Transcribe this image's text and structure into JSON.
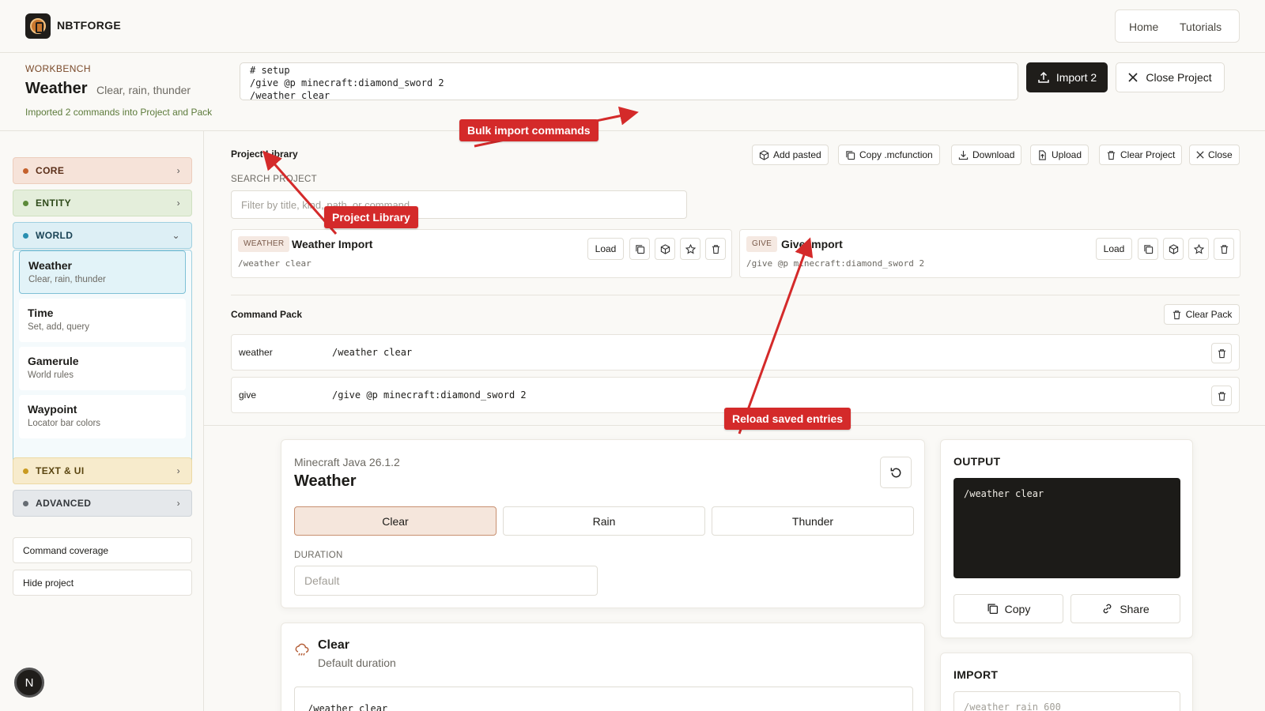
{
  "header": {
    "brand": "NBTFORGE",
    "nav": [
      {
        "label": "Home"
      },
      {
        "label": "Tutorials"
      }
    ]
  },
  "workbench": {
    "label": "WORKBENCH",
    "title": "Weather",
    "subtitle": "Clear, rain, thunder",
    "status": "Imported 2 commands into Project and Pack",
    "import_text": "# setup\n/give @p minecraft:diamond_sword 2\n/weather clear",
    "import_button": "Import 2",
    "close_project_button": "Close Project"
  },
  "sidebar": {
    "categories": [
      {
        "label": "CORE",
        "color": "#c4612c"
      },
      {
        "label": "ENTITY",
        "color": "#5c8a3a"
      },
      {
        "label": "WORLD",
        "color": "#2a8fb0"
      },
      {
        "label": "TEXT & UI",
        "color": "#c99a20"
      },
      {
        "label": "ADVANCED",
        "color": "#666c73"
      }
    ],
    "world_items": [
      {
        "title": "Weather",
        "subtitle": "Clear, rain, thunder"
      },
      {
        "title": "Time",
        "subtitle": "Set, add, query"
      },
      {
        "title": "Gamerule",
        "subtitle": "World rules"
      },
      {
        "title": "Waypoint",
        "subtitle": "Locator bar colors"
      }
    ],
    "command_coverage": "Command coverage",
    "hide_project": "Hide project",
    "bubble": "N"
  },
  "library": {
    "title": "Project Library",
    "toolbar": {
      "add_pasted": "Add pasted",
      "copy_mcfunction": "Copy .mcfunction",
      "download": "Download",
      "upload": "Upload",
      "clear_project": "Clear Project",
      "close": "Close"
    },
    "search_label": "SEARCH PROJECT",
    "search_placeholder": "Filter by title, kind, path, or command",
    "entries": [
      {
        "kind": "WEATHER",
        "title": "Weather Import",
        "command": "/weather clear",
        "load": "Load"
      },
      {
        "kind": "GIVE",
        "title": "Give Import",
        "command": "/give @p minecraft:diamond_sword 2",
        "load": "Load"
      }
    ]
  },
  "pack": {
    "title": "Command Pack",
    "clear_button": "Clear Pack",
    "rows": [
      {
        "kind": "weather",
        "command": "/weather clear"
      },
      {
        "kind": "give",
        "command": "/give @p minecraft:diamond_sword 2"
      }
    ]
  },
  "editor": {
    "version": "Minecraft Java 26.1.2",
    "title": "Weather",
    "options": [
      "Clear",
      "Rain",
      "Thunder"
    ],
    "selected": "Clear",
    "duration_label": "DURATION",
    "duration_placeholder": "Default"
  },
  "output": {
    "title": "OUTPUT",
    "command": "/weather clear",
    "copy": "Copy",
    "share": "Share"
  },
  "clear_card": {
    "title": "Clear",
    "subtitle": "Default duration",
    "command": "/weather clear"
  },
  "import_panel": {
    "title": "IMPORT",
    "placeholder": "/weather rain 600"
  },
  "annotations": {
    "bulk_import": "Bulk import commands",
    "project_library": "Project Library",
    "reload": "Reload saved entries"
  },
  "colors": {
    "accent_dark": "#1f1d1a",
    "callout_red": "#d42a2a",
    "world_highlight": "#9fd0e0"
  }
}
